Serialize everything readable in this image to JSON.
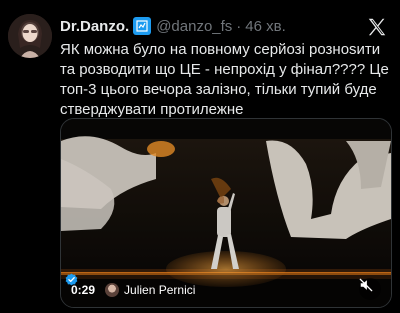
{
  "tweet": {
    "display_name": "Dr.Danzo.",
    "verified_icon": "square-badge-icon",
    "handle": "@danzo_fs",
    "separator": "·",
    "time": "46 хв.",
    "text": "ЯК можна було на повному серйозі рознosити та розводити що ЦЕ - непрохід у фінал???? Це топ-3 цього вечора залізно, тільки тупий буде стверджувати протилежне"
  },
  "video": {
    "timestamp": "0:29",
    "credit_name": "Julien Pernici",
    "mute_icon": "speaker-muted-icon"
  },
  "colors": {
    "background": "#000000",
    "text": "#e7e9ea",
    "secondary": "#71767b",
    "verified": "#1d9bf0",
    "stage_flame": "#ff8a1c"
  }
}
